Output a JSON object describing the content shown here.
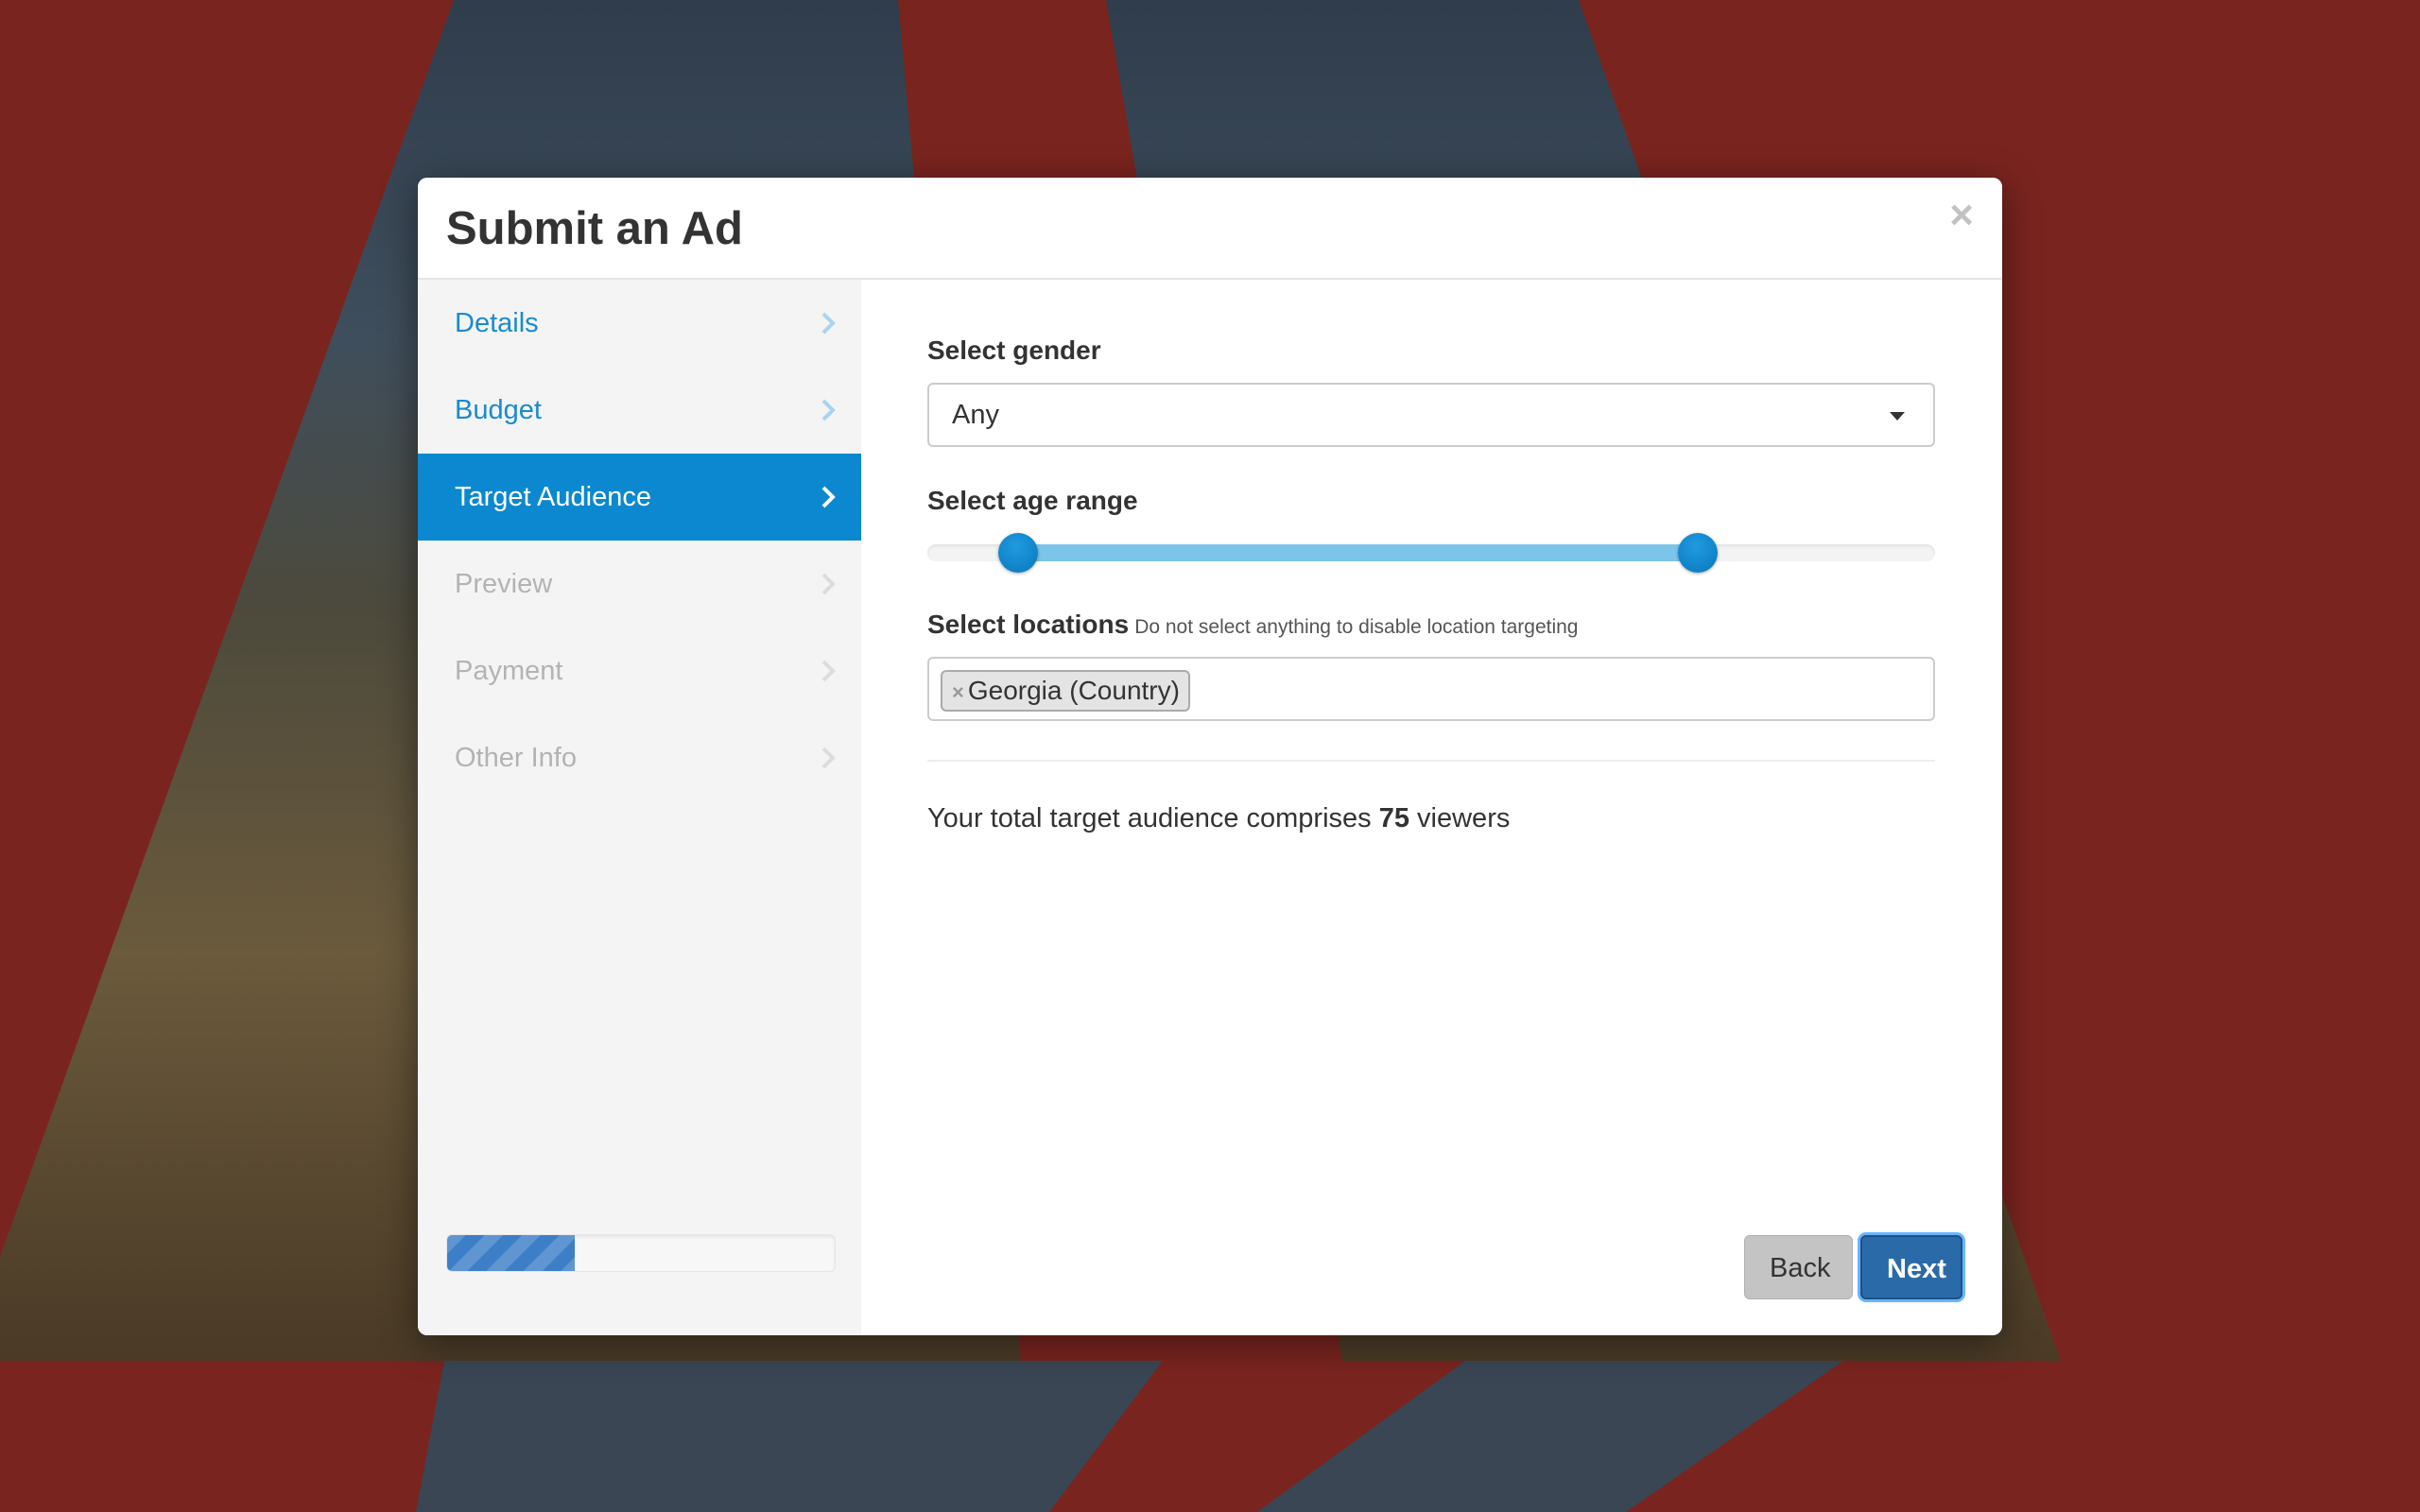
{
  "modal": {
    "title": "Submit an Ad",
    "close_label": "×"
  },
  "sidebar": {
    "steps": [
      {
        "label": "Details",
        "state": "completed"
      },
      {
        "label": "Budget",
        "state": "completed"
      },
      {
        "label": "Target Audience",
        "state": "active"
      },
      {
        "label": "Preview",
        "state": "disabled"
      },
      {
        "label": "Payment",
        "state": "disabled"
      },
      {
        "label": "Other Info",
        "state": "disabled"
      }
    ],
    "progress_fraction": 0.33
  },
  "form": {
    "gender_label": "Select gender",
    "gender_value": "Any",
    "age_label": "Select age range",
    "age_range_fraction": [
      0.09,
      0.765
    ],
    "locations_label": "Select locations",
    "locations_hint": "Do not select anything to disable location targeting",
    "locations_selected": [
      "Georgia (Country)"
    ],
    "tag_remove_label": "×",
    "summary_prefix": "Your total target audience comprises",
    "summary_count": "75",
    "summary_suffix": "viewers"
  },
  "buttons": {
    "back_label": "Back",
    "next_label": "Next"
  },
  "colors": {
    "background": "#7a241f",
    "accent": "#0b88cf",
    "primary_button": "#2a6aa8"
  }
}
